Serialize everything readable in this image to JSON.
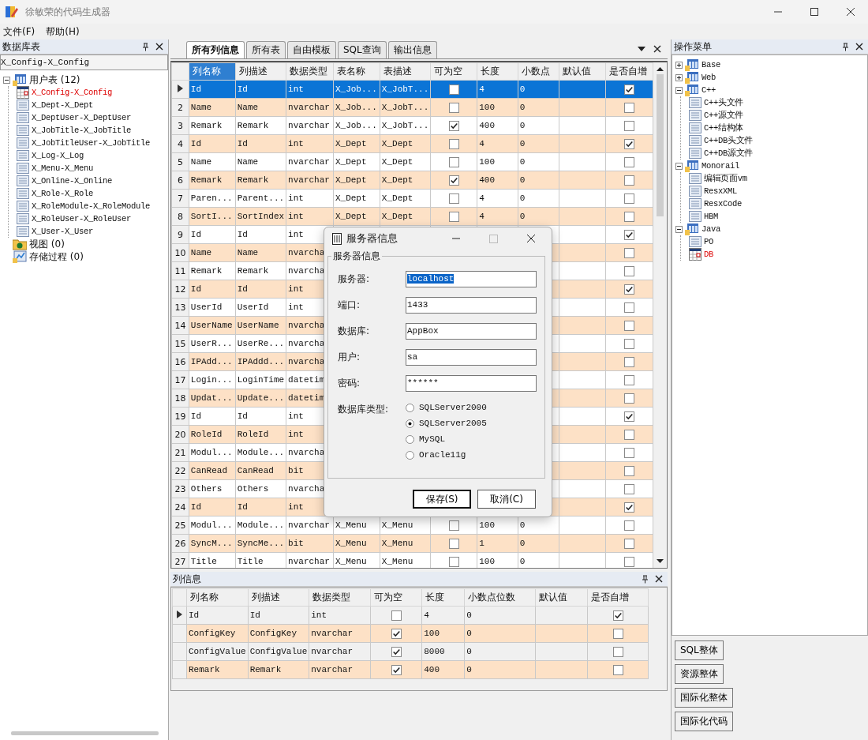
{
  "window": {
    "title": "徐敏荣的代码生成器"
  },
  "menu": [
    "文件(F)",
    "帮助(H)"
  ],
  "left_panel": {
    "title": "数据库表",
    "table_field": "X_Config-X_Config",
    "tree": [
      {
        "label": "用户表 (12)",
        "kind": "tables",
        "expanded": true,
        "children": [
          {
            "label": "X_Config-X_Config",
            "selected": true
          },
          {
            "label": "X_Dept-X_Dept",
            "selected": false
          },
          {
            "label": "X_DeptUser-X_DeptUser",
            "selected": false
          },
          {
            "label": "X_JobTitle-X_JobTitle",
            "selected": false
          },
          {
            "label": "X_JobTitleUser-X_JobTitle",
            "selected": false
          },
          {
            "label": "X_Log-X_Log",
            "selected": false
          },
          {
            "label": "X_Menu-X_Menu",
            "selected": false
          },
          {
            "label": "X_Online-X_Online",
            "selected": false
          },
          {
            "label": "X_Role-X_Role",
            "selected": false
          },
          {
            "label": "X_RoleModule-X_RoleModule",
            "selected": false
          },
          {
            "label": "X_RoleUser-X_RoleUser",
            "selected": false
          },
          {
            "label": "X_User-X_User",
            "selected": false
          }
        ]
      },
      {
        "label": "视图 (0)",
        "kind": "views"
      },
      {
        "label": "存储过程 (0)",
        "kind": "procedures"
      }
    ]
  },
  "tabs": [
    {
      "label": "所有列信息",
      "selected": true
    },
    {
      "label": "所有表",
      "selected": false
    },
    {
      "label": "自由模板",
      "selected": false
    },
    {
      "label": "SQL查询",
      "selected": false
    },
    {
      "label": "输出信息",
      "selected": false
    }
  ],
  "grid": {
    "columns": [
      {
        "label": "列名称",
        "selected": true
      },
      {
        "label": "列描述",
        "selected": false
      },
      {
        "label": "数据类型",
        "selected": false
      },
      {
        "label": "表名称",
        "selected": false
      },
      {
        "label": "表描述",
        "selected": false
      },
      {
        "label": "可为空",
        "selected": false
      },
      {
        "label": "长度",
        "selected": false
      },
      {
        "label": "小数点",
        "selected": false
      },
      {
        "label": "默认值",
        "selected": false
      },
      {
        "label": "是否自增",
        "selected": false
      }
    ],
    "rows": [
      {
        "selected": true,
        "column_name": "Id",
        "description": "Id",
        "data_type": "int",
        "table_name": "X_Job...",
        "table_description": "X_JobT...",
        "nullable": false,
        "length": "4",
        "decimals": "0",
        "auto_increment": true
      },
      {
        "selected": false,
        "number": "2",
        "column_name": "Name",
        "description": "Name",
        "data_type": "nvarchar",
        "table_name": "X_Job...",
        "table_description": "X_JobT...",
        "nullable": false,
        "length": "100",
        "decimals": "0",
        "auto_increment": false
      },
      {
        "selected": false,
        "number": "3",
        "column_name": "Remark",
        "description": "Remark",
        "data_type": "nvarchar",
        "table_name": "X_Job...",
        "table_description": "X_JobT...",
        "nullable": true,
        "length": "400",
        "decimals": "0",
        "auto_increment": false
      },
      {
        "selected": false,
        "number": "4",
        "column_name": "Id",
        "description": "Id",
        "data_type": "int",
        "table_name": "X_Dept",
        "table_description": "X_Dept",
        "nullable": false,
        "length": "4",
        "decimals": "0",
        "auto_increment": true
      },
      {
        "selected": false,
        "number": "5",
        "column_name": "Name",
        "description": "Name",
        "data_type": "nvarchar",
        "table_name": "X_Dept",
        "table_description": "X_Dept",
        "nullable": false,
        "length": "100",
        "decimals": "0",
        "auto_increment": false
      },
      {
        "selected": false,
        "number": "6",
        "column_name": "Remark",
        "description": "Remark",
        "data_type": "nvarchar",
        "table_name": "X_Dept",
        "table_description": "X_Dept",
        "nullable": true,
        "length": "400",
        "decimals": "0",
        "auto_increment": false
      },
      {
        "selected": false,
        "number": "7",
        "column_name": "Paren...",
        "description": "Parent...",
        "data_type": "int",
        "table_name": "X_Dept",
        "table_description": "X_Dept",
        "nullable": false,
        "length": "4",
        "decimals": "0",
        "auto_increment": false
      },
      {
        "selected": false,
        "number": "8",
        "column_name": "SortI...",
        "description": "SortIndex",
        "data_type": "int",
        "table_name": "X_Dept",
        "table_description": "X_Dept",
        "nullable": false,
        "length": "4",
        "decimals": "0",
        "auto_increment": false
      },
      {
        "selected": false,
        "number": "9",
        "column_name": "Id",
        "description": "Id",
        "data_type": "int",
        "auto_increment": true
      },
      {
        "selected": false,
        "number": "10",
        "column_name": "Name",
        "description": "Name",
        "data_type": "nvarcha",
        "auto_increment": false
      },
      {
        "selected": false,
        "number": "11",
        "column_name": "Remark",
        "description": "Remark",
        "data_type": "nvarcha",
        "auto_increment": false
      },
      {
        "selected": false,
        "number": "12",
        "column_name": "Id",
        "description": "Id",
        "data_type": "int",
        "auto_increment": true
      },
      {
        "selected": false,
        "number": "13",
        "column_name": "UserId",
        "description": "UserId",
        "data_type": "int",
        "auto_increment": false
      },
      {
        "selected": false,
        "number": "14",
        "column_name": "UserName",
        "description": "UserName",
        "data_type": "nvarcha",
        "auto_increment": false
      },
      {
        "selected": false,
        "number": "15",
        "column_name": "UserR...",
        "description": "UserRe...",
        "data_type": "nvarcha",
        "auto_increment": false
      },
      {
        "selected": false,
        "number": "16",
        "column_name": "IPAdd...",
        "description": "IPAddd...",
        "data_type": "nvarcha",
        "auto_increment": false
      },
      {
        "selected": false,
        "number": "17",
        "column_name": "Login...",
        "description": "LoginTime",
        "data_type": "datetim",
        "auto_increment": false
      },
      {
        "selected": false,
        "number": "18",
        "column_name": "Updat...",
        "description": "Update...",
        "data_type": "datetim",
        "auto_increment": false
      },
      {
        "selected": false,
        "number": "19",
        "column_name": "Id",
        "description": "Id",
        "data_type": "int",
        "auto_increment": true
      },
      {
        "selected": false,
        "number": "20",
        "column_name": "RoleId",
        "description": "RoleId",
        "data_type": "int",
        "auto_increment": false
      },
      {
        "selected": false,
        "number": "21",
        "column_name": "Modul...",
        "description": "Module...",
        "data_type": "nvarcha",
        "auto_increment": false
      },
      {
        "selected": false,
        "number": "22",
        "column_name": "CanRead",
        "description": "CanRead",
        "data_type": "bit",
        "auto_increment": false
      },
      {
        "selected": false,
        "number": "23",
        "column_name": "Others",
        "description": "Others",
        "data_type": "nvarcha",
        "auto_increment": false
      },
      {
        "selected": false,
        "number": "24",
        "column_name": "Id",
        "description": "Id",
        "data_type": "int",
        "auto_increment": true
      },
      {
        "selected": false,
        "number": "25",
        "column_name": "Modul...",
        "description": "Module...",
        "data_type": "nvarchar",
        "table_name": "X_Menu",
        "table_description": "X_Menu",
        "nullable": false,
        "length": "100",
        "decimals": "0",
        "auto_increment": false
      },
      {
        "selected": false,
        "number": "26",
        "column_name": "SyncM...",
        "description": "SyncMe...",
        "data_type": "bit",
        "table_name": "X_Menu",
        "table_description": "X_Menu",
        "nullable": false,
        "length": "1",
        "decimals": "0",
        "auto_increment": false
      },
      {
        "selected": false,
        "number": "27",
        "column_name": "Title",
        "description": "Title",
        "data_type": "nvarchar",
        "table_name": "X_Menu",
        "table_description": "X_Menu",
        "nullable": false,
        "length": "100",
        "decimals": "0",
        "auto_increment": false
      }
    ]
  },
  "column_info": {
    "title": "列信息",
    "columns": [
      "列名称",
      "列描述",
      "数据类型",
      "可为空",
      "长度",
      "小数点位数",
      "默认值",
      "是否自增"
    ],
    "rows": [
      {
        "selected": true,
        "column_name": "Id",
        "description": "Id",
        "data_type": "int",
        "nullable": false,
        "length": "4",
        "decimals": "0",
        "auto_increment": true
      },
      {
        "selected": false,
        "column_name": "ConfigKey",
        "description": "ConfigKey",
        "data_type": "nvarchar",
        "nullable": true,
        "length": "100",
        "decimals": "0",
        "auto_increment": false
      },
      {
        "selected": false,
        "column_name": "ConfigValue",
        "description": "ConfigValue",
        "data_type": "nvarchar",
        "nullable": true,
        "length": "8000",
        "decimals": "0",
        "auto_increment": false
      },
      {
        "selected": false,
        "column_name": "Remark",
        "description": "Remark",
        "data_type": "nvarchar",
        "nullable": true,
        "length": "400",
        "decimals": "0",
        "auto_increment": false
      }
    ]
  },
  "right_panel": {
    "title": "操作菜单",
    "tree": [
      {
        "label": "Base",
        "expanded": false
      },
      {
        "label": "Web",
        "expanded": false
      },
      {
        "label": "C++",
        "expanded": true,
        "children": [
          {
            "label": "C++头文件",
            "selected": false
          },
          {
            "label": "C++源文件",
            "selected": false
          },
          {
            "label": "C++结构体",
            "selected": false
          },
          {
            "label": "C++DB头文件",
            "selected": false
          },
          {
            "label": "C++DB源文件",
            "selected": false
          }
        ]
      },
      {
        "label": "Monorail",
        "expanded": true,
        "children": [
          {
            "label": "编辑页面vm",
            "selected": false
          },
          {
            "label": "ResxXML",
            "selected": false
          },
          {
            "label": "ResxCode",
            "selected": false
          },
          {
            "label": "HBM",
            "selected": false
          }
        ]
      },
      {
        "label": "Java",
        "expanded": true,
        "children": [
          {
            "label": "PO",
            "selected": false
          },
          {
            "label": "DB",
            "selected": true
          }
        ]
      }
    ],
    "buttons": [
      "SQL整体",
      "资源整体",
      "国际化整体",
      "国际化代码"
    ]
  },
  "dialog": {
    "title": "服务器信息",
    "group": "服务器信息",
    "fields": [
      {
        "label": "服务器:",
        "value": "localhost",
        "text_selected": true
      },
      {
        "label": "端口:",
        "value": "1433",
        "text_selected": false
      },
      {
        "label": "数据库:",
        "value": "AppBox",
        "text_selected": false
      },
      {
        "label": "用户:",
        "value": "sa",
        "text_selected": false
      },
      {
        "label": "密码:",
        "value": "******",
        "text_selected": false
      }
    ],
    "db_type_label": "数据库类型:",
    "options": [
      {
        "label": "SQLServer2000",
        "selected": false
      },
      {
        "label": "SQLServer2005",
        "selected": true
      },
      {
        "label": "MySQL",
        "selected": false
      },
      {
        "label": "Oracle11g",
        "selected": false
      }
    ],
    "buttons": [
      {
        "label": "保存(S)",
        "default": true
      },
      {
        "label": "取消(C)",
        "default": false
      }
    ]
  }
}
